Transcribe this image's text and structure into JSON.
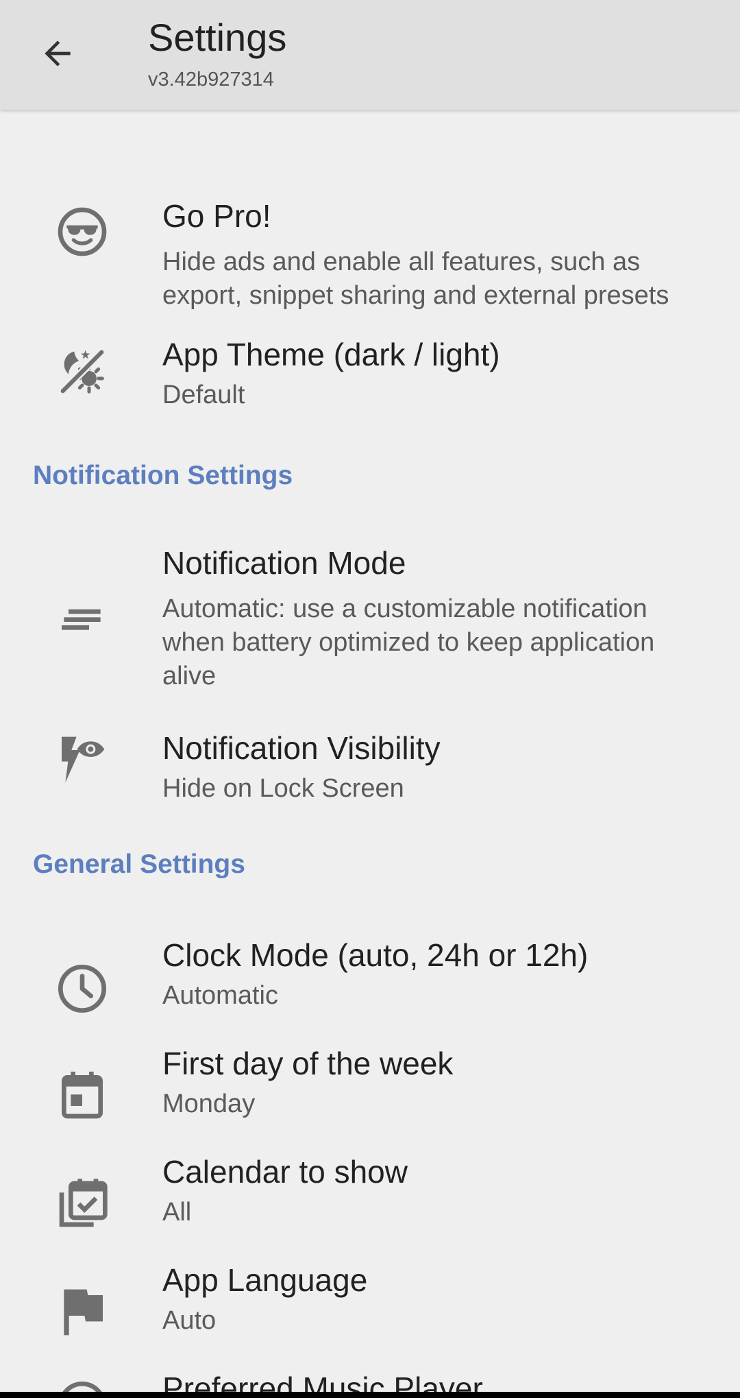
{
  "appbar": {
    "title": "Settings",
    "subtitle": "v3.42b927314"
  },
  "prefs": {
    "go_pro": {
      "title": "Go Pro!",
      "summary": "Hide ads and enable all features, such as export, snippet sharing and external presets",
      "icon": "sunglasses-face-icon"
    },
    "app_theme": {
      "title": "App Theme (dark / light)",
      "summary": "Default",
      "icon": "theme-icon"
    },
    "notification_mode": {
      "title": "Notification Mode",
      "summary": "Automatic: use a customizable notification when battery optimized to keep application alive",
      "icon": "short-text-icon"
    },
    "notification_visibility": {
      "title": "Notification Visibility",
      "summary": "Hide on Lock Screen",
      "icon": "flash-eye-icon"
    },
    "clock_mode": {
      "title": "Clock Mode (auto, 24h or 12h)",
      "summary": "Automatic",
      "icon": "clock-icon"
    },
    "first_day": {
      "title": "First day of the week",
      "summary": "Monday",
      "icon": "calendar-icon"
    },
    "calendar_to_show": {
      "title": "Calendar to show",
      "summary": "All",
      "icon": "calendar-multiple-check-icon"
    },
    "app_language": {
      "title": "App Language",
      "summary": "Auto",
      "icon": "flag-icon"
    },
    "music_player": {
      "title": "Preferred Music Player",
      "icon": "music-player-icon"
    }
  },
  "sections": {
    "notification": "Notification Settings",
    "general": "General Settings"
  },
  "colors": {
    "appbar_bg": "#e0e0e0",
    "background": "#efefef",
    "accent": "#5c7fbf",
    "icon": "#6f6f6f"
  }
}
